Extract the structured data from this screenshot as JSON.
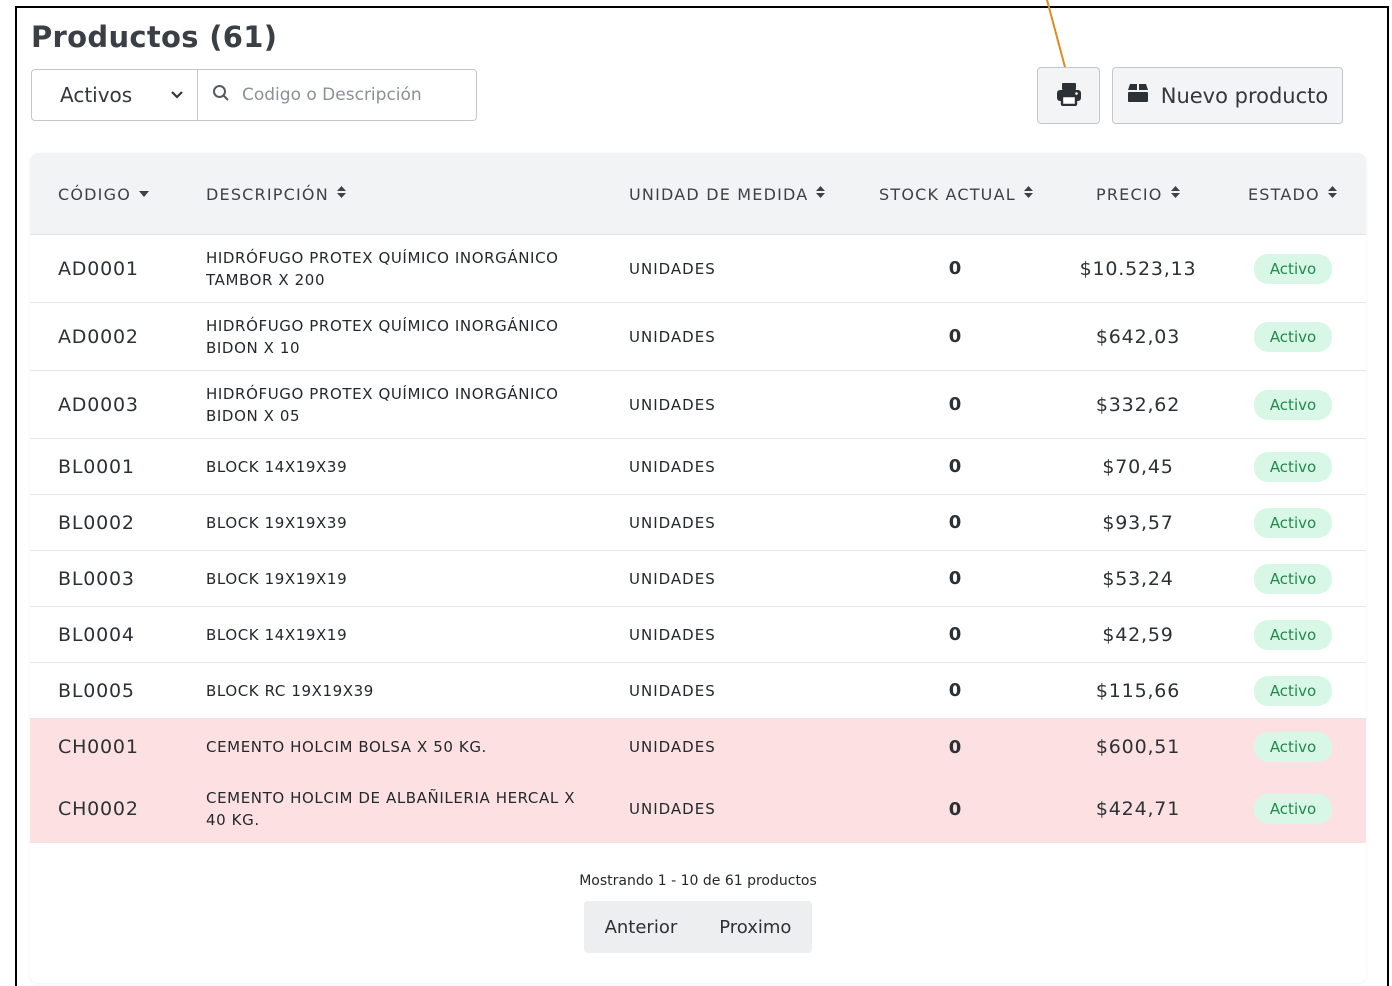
{
  "page": {
    "title": "Productos (61)"
  },
  "filter": {
    "status_value": "Activos",
    "search_placeholder": "Codigo o Descripción"
  },
  "actions": {
    "new_product_label": "Nuevo producto"
  },
  "table": {
    "headers": {
      "code": "CÓDIGO",
      "description": "DESCRIPCIÓN",
      "unit": "UNIDAD DE MEDIDA",
      "stock": "STOCK ACTUAL",
      "price": "PRECIO",
      "status": "ESTADO"
    },
    "rows": [
      {
        "code": "AD0001",
        "description": "HIDRÓFUGO PROTEX QUÍMICO INORGÁNICO TAMBOR X 200",
        "unit": "UNIDADES",
        "stock": "0",
        "price": "$10.523,13",
        "status": "Activo",
        "highlight": false
      },
      {
        "code": "AD0002",
        "description": "HIDRÓFUGO PROTEX QUÍMICO INORGÁNICO BIDON X 10",
        "unit": "UNIDADES",
        "stock": "0",
        "price": "$642,03",
        "status": "Activo",
        "highlight": false
      },
      {
        "code": "AD0003",
        "description": "HIDRÓFUGO PROTEX QUÍMICO INORGÁNICO BIDON X 05",
        "unit": "UNIDADES",
        "stock": "0",
        "price": "$332,62",
        "status": "Activo",
        "highlight": false
      },
      {
        "code": "BL0001",
        "description": "BLOCK 14X19X39",
        "unit": "UNIDADES",
        "stock": "0",
        "price": "$70,45",
        "status": "Activo",
        "highlight": false
      },
      {
        "code": "BL0002",
        "description": "BLOCK 19X19X39",
        "unit": "UNIDADES",
        "stock": "0",
        "price": "$93,57",
        "status": "Activo",
        "highlight": false
      },
      {
        "code": "BL0003",
        "description": "BLOCK 19X19X19",
        "unit": "UNIDADES",
        "stock": "0",
        "price": "$53,24",
        "status": "Activo",
        "highlight": false
      },
      {
        "code": "BL0004",
        "description": "BLOCK 14X19X19",
        "unit": "UNIDADES",
        "stock": "0",
        "price": "$42,59",
        "status": "Activo",
        "highlight": false
      },
      {
        "code": "BL0005",
        "description": "BLOCK RC 19X19X39",
        "unit": "UNIDADES",
        "stock": "0",
        "price": "$115,66",
        "status": "Activo",
        "highlight": false
      },
      {
        "code": "CH0001",
        "description": "CEMENTO HOLCIM BOLSA X 50 KG.",
        "unit": "UNIDADES",
        "stock": "0",
        "price": "$600,51",
        "status": "Activo",
        "highlight": true
      },
      {
        "code": "CH0002",
        "description": "CEMENTO HOLCIM DE ALBAÑILERIA HERCAL X 40 KG.",
        "unit": "UNIDADES",
        "stock": "0",
        "price": "$424,71",
        "status": "Activo",
        "highlight": true
      }
    ]
  },
  "pagination": {
    "summary": "Mostrando 1 - 10 de 61 productos",
    "prev_label": "Anterior",
    "next_label": "Proximo"
  },
  "colors": {
    "active_badge_bg": "#d9f7e6",
    "active_badge_text": "#1f8a4c",
    "highlight_row": "#fde1e2",
    "annotation_pointer": "#e08a1e"
  }
}
